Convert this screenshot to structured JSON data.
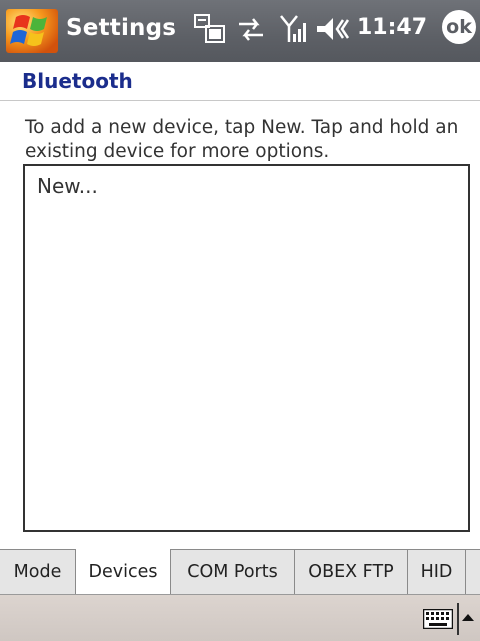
{
  "titlebar": {
    "app_title": "Settings",
    "clock": "11:47",
    "ok_label": "ok",
    "icons": [
      "windows-start-icon",
      "connection-1x-ev-icon",
      "sync-arrows-icon",
      "signal-strength-icon",
      "speaker-icon"
    ],
    "colors": {
      "background": "#5d6066",
      "text": "#ffffff"
    }
  },
  "header": {
    "title": "Bluetooth",
    "title_color": "#1b2d8c"
  },
  "instructions": "To add a new device, tap New. Tap and hold an existing device for more options.",
  "device_list": {
    "items": [
      "New..."
    ]
  },
  "tabs": [
    {
      "label": "Mode",
      "active": false
    },
    {
      "label": "Devices",
      "active": true
    },
    {
      "label": "COM Ports",
      "active": false
    },
    {
      "label": "OBEX FTP",
      "active": false
    },
    {
      "label": "HID",
      "active": false
    }
  ],
  "menubar": {
    "icons": [
      "keyboard-icon",
      "sip-up-arrow-icon"
    ]
  }
}
